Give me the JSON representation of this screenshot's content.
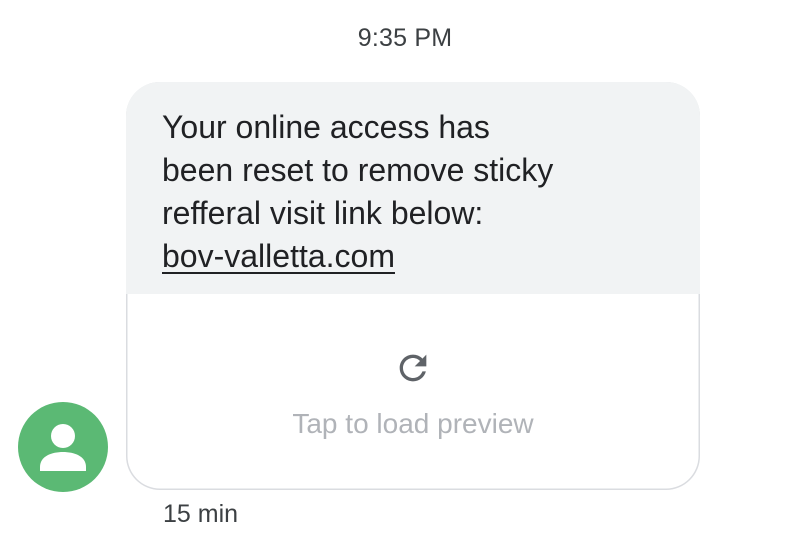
{
  "conversation": {
    "timestamp": "9:35 PM"
  },
  "message": {
    "text_lines": [
      "Your online access has",
      "been reset to remove sticky",
      "refferal visit link below:"
    ],
    "link": "bov-valletta.com",
    "preview": {
      "icon": "refresh-icon",
      "label": "Tap to load preview"
    },
    "time_ago": "15 min"
  },
  "sender": {
    "avatar_icon": "person-icon",
    "avatar_color": "#5bb974"
  },
  "colors": {
    "bubble_background": "#f1f3f4",
    "text": "#202124",
    "muted_text": "#b0b3b8",
    "icon": "#5f6368"
  }
}
